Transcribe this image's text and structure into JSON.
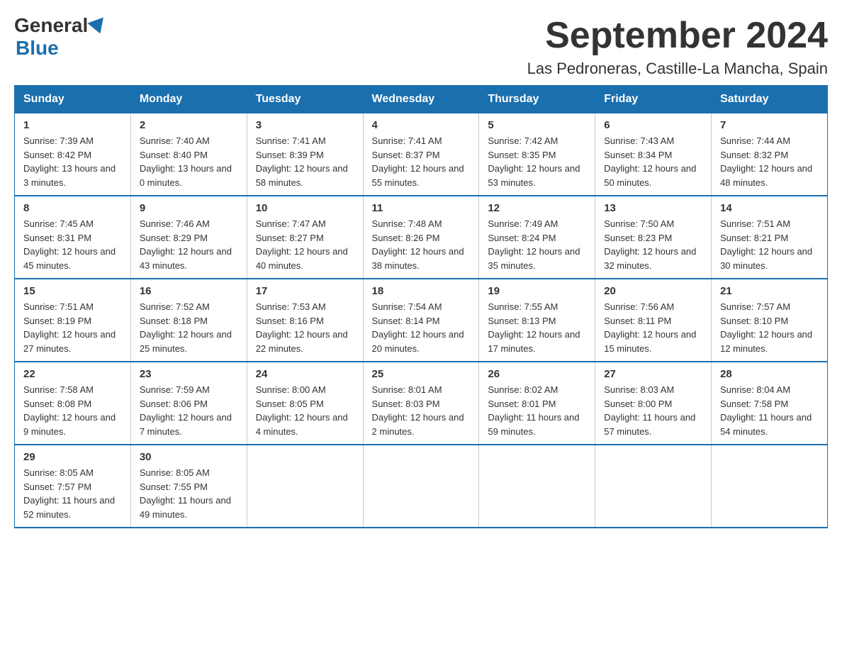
{
  "header": {
    "logo_general": "General",
    "logo_blue": "Blue",
    "title": "September 2024",
    "location": "Las Pedroneras, Castille-La Mancha, Spain"
  },
  "days_of_week": [
    "Sunday",
    "Monday",
    "Tuesday",
    "Wednesday",
    "Thursday",
    "Friday",
    "Saturday"
  ],
  "weeks": [
    [
      {
        "day": "1",
        "sunrise": "7:39 AM",
        "sunset": "8:42 PM",
        "daylight": "13 hours and 3 minutes."
      },
      {
        "day": "2",
        "sunrise": "7:40 AM",
        "sunset": "8:40 PM",
        "daylight": "13 hours and 0 minutes."
      },
      {
        "day": "3",
        "sunrise": "7:41 AM",
        "sunset": "8:39 PM",
        "daylight": "12 hours and 58 minutes."
      },
      {
        "day": "4",
        "sunrise": "7:41 AM",
        "sunset": "8:37 PM",
        "daylight": "12 hours and 55 minutes."
      },
      {
        "day": "5",
        "sunrise": "7:42 AM",
        "sunset": "8:35 PM",
        "daylight": "12 hours and 53 minutes."
      },
      {
        "day": "6",
        "sunrise": "7:43 AM",
        "sunset": "8:34 PM",
        "daylight": "12 hours and 50 minutes."
      },
      {
        "day": "7",
        "sunrise": "7:44 AM",
        "sunset": "8:32 PM",
        "daylight": "12 hours and 48 minutes."
      }
    ],
    [
      {
        "day": "8",
        "sunrise": "7:45 AM",
        "sunset": "8:31 PM",
        "daylight": "12 hours and 45 minutes."
      },
      {
        "day": "9",
        "sunrise": "7:46 AM",
        "sunset": "8:29 PM",
        "daylight": "12 hours and 43 minutes."
      },
      {
        "day": "10",
        "sunrise": "7:47 AM",
        "sunset": "8:27 PM",
        "daylight": "12 hours and 40 minutes."
      },
      {
        "day": "11",
        "sunrise": "7:48 AM",
        "sunset": "8:26 PM",
        "daylight": "12 hours and 38 minutes."
      },
      {
        "day": "12",
        "sunrise": "7:49 AM",
        "sunset": "8:24 PM",
        "daylight": "12 hours and 35 minutes."
      },
      {
        "day": "13",
        "sunrise": "7:50 AM",
        "sunset": "8:23 PM",
        "daylight": "12 hours and 32 minutes."
      },
      {
        "day": "14",
        "sunrise": "7:51 AM",
        "sunset": "8:21 PM",
        "daylight": "12 hours and 30 minutes."
      }
    ],
    [
      {
        "day": "15",
        "sunrise": "7:51 AM",
        "sunset": "8:19 PM",
        "daylight": "12 hours and 27 minutes."
      },
      {
        "day": "16",
        "sunrise": "7:52 AM",
        "sunset": "8:18 PM",
        "daylight": "12 hours and 25 minutes."
      },
      {
        "day": "17",
        "sunrise": "7:53 AM",
        "sunset": "8:16 PM",
        "daylight": "12 hours and 22 minutes."
      },
      {
        "day": "18",
        "sunrise": "7:54 AM",
        "sunset": "8:14 PM",
        "daylight": "12 hours and 20 minutes."
      },
      {
        "day": "19",
        "sunrise": "7:55 AM",
        "sunset": "8:13 PM",
        "daylight": "12 hours and 17 minutes."
      },
      {
        "day": "20",
        "sunrise": "7:56 AM",
        "sunset": "8:11 PM",
        "daylight": "12 hours and 15 minutes."
      },
      {
        "day": "21",
        "sunrise": "7:57 AM",
        "sunset": "8:10 PM",
        "daylight": "12 hours and 12 minutes."
      }
    ],
    [
      {
        "day": "22",
        "sunrise": "7:58 AM",
        "sunset": "8:08 PM",
        "daylight": "12 hours and 9 minutes."
      },
      {
        "day": "23",
        "sunrise": "7:59 AM",
        "sunset": "8:06 PM",
        "daylight": "12 hours and 7 minutes."
      },
      {
        "day": "24",
        "sunrise": "8:00 AM",
        "sunset": "8:05 PM",
        "daylight": "12 hours and 4 minutes."
      },
      {
        "day": "25",
        "sunrise": "8:01 AM",
        "sunset": "8:03 PM",
        "daylight": "12 hours and 2 minutes."
      },
      {
        "day": "26",
        "sunrise": "8:02 AM",
        "sunset": "8:01 PM",
        "daylight": "11 hours and 59 minutes."
      },
      {
        "day": "27",
        "sunrise": "8:03 AM",
        "sunset": "8:00 PM",
        "daylight": "11 hours and 57 minutes."
      },
      {
        "day": "28",
        "sunrise": "8:04 AM",
        "sunset": "7:58 PM",
        "daylight": "11 hours and 54 minutes."
      }
    ],
    [
      {
        "day": "29",
        "sunrise": "8:05 AM",
        "sunset": "7:57 PM",
        "daylight": "11 hours and 52 minutes."
      },
      {
        "day": "30",
        "sunrise": "8:05 AM",
        "sunset": "7:55 PM",
        "daylight": "11 hours and 49 minutes."
      },
      null,
      null,
      null,
      null,
      null
    ]
  ],
  "labels": {
    "sunrise": "Sunrise:",
    "sunset": "Sunset:",
    "daylight": "Daylight:"
  }
}
